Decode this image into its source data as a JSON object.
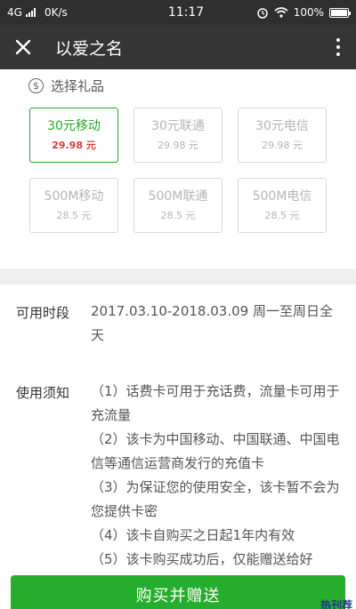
{
  "status": {
    "network": "4G",
    "speed": "0K/s",
    "time": "11:17",
    "battery": "100%",
    "battery_level": 1.0
  },
  "nav": {
    "title": "以爱之名"
  },
  "gift": {
    "header": "选择礼品",
    "items": [
      {
        "name": "30元移动",
        "price": "29.98 元",
        "selected": true
      },
      {
        "name": "30元联通",
        "price": "29.98 元",
        "selected": false
      },
      {
        "name": "30元电信",
        "price": "29.98 元",
        "selected": false
      },
      {
        "name": "500M移动",
        "price": "28.5 元",
        "selected": false
      },
      {
        "name": "500M联通",
        "price": "28.5 元",
        "selected": false
      },
      {
        "name": "500M电信",
        "price": "28.5 元",
        "selected": false
      }
    ]
  },
  "info": {
    "period_label": "可用时段",
    "period_value": "2017.03.10-2018.03.09 周一至周日全天",
    "notice_label": "使用须知",
    "notice_lines": [
      "（1）话费卡可用于充话费，流量卡可用于充流量",
      "（2）该卡为中国移动、中国联通、中国电信等通信运营商发行的充值卡",
      "（3）为保证您的使用安全，该卡暂不会为您提供卡密",
      "（4）该卡自购买之日起1年内有效",
      "（5）该卡购买成功后，仅能赠送给好"
    ]
  },
  "buy_button": "购买并赠送",
  "watermark": "热刊荐",
  "colors": {
    "accent_green": "#27ad2d",
    "price_red": "#e03a3a",
    "nav_bg": "#353535"
  }
}
